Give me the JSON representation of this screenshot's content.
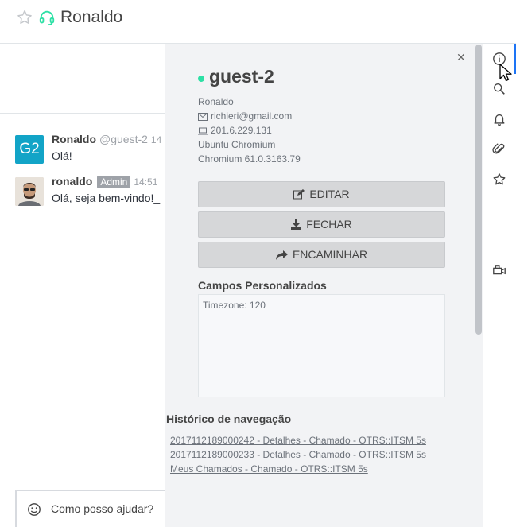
{
  "header": {
    "room_name": "Ronaldo"
  },
  "messages": [
    {
      "avatar_text": "G2",
      "name": "Ronaldo",
      "username": "@guest-2",
      "time": "14",
      "text": "Olá!"
    },
    {
      "name": "ronaldo",
      "badge": "Admin",
      "time": "14:51",
      "text": "Olá, seja bem-vindo!_"
    }
  ],
  "composer": {
    "placeholder": "Como posso ajudar?"
  },
  "visitor": {
    "name": "guest-2",
    "display_name": "Ronaldo",
    "email": "richieri@gmail.com",
    "ip": "201.6.229.131",
    "os_browser": "Ubuntu Chromium",
    "browser_version": "Chromium 61.0.3163.79",
    "status_color": "#2de0a5"
  },
  "actions": {
    "edit": "EDITAR",
    "close": "FECHAR",
    "forward": "ENCAMINHAR"
  },
  "custom_fields": {
    "title": "Campos Personalizados",
    "timezone": "Timezone: 120"
  },
  "history": {
    "title": "Histórico de navegação",
    "items": [
      "2017112189000242 - Detalhes - Chamado - OTRS::ITSM 5s",
      "2017112189000233 - Detalhes - Chamado - OTRS::ITSM 5s",
      "Meus Chamados - Chamado - OTRS::ITSM 5s"
    ]
  },
  "toolbar_icons": [
    "info-icon",
    "search-icon",
    "bell-icon",
    "paperclip-icon",
    "star-icon",
    "video-icon"
  ],
  "colors": {
    "accent": "#1d74f5",
    "avatar": "#12a4c7",
    "headset": "#2de0a5"
  }
}
